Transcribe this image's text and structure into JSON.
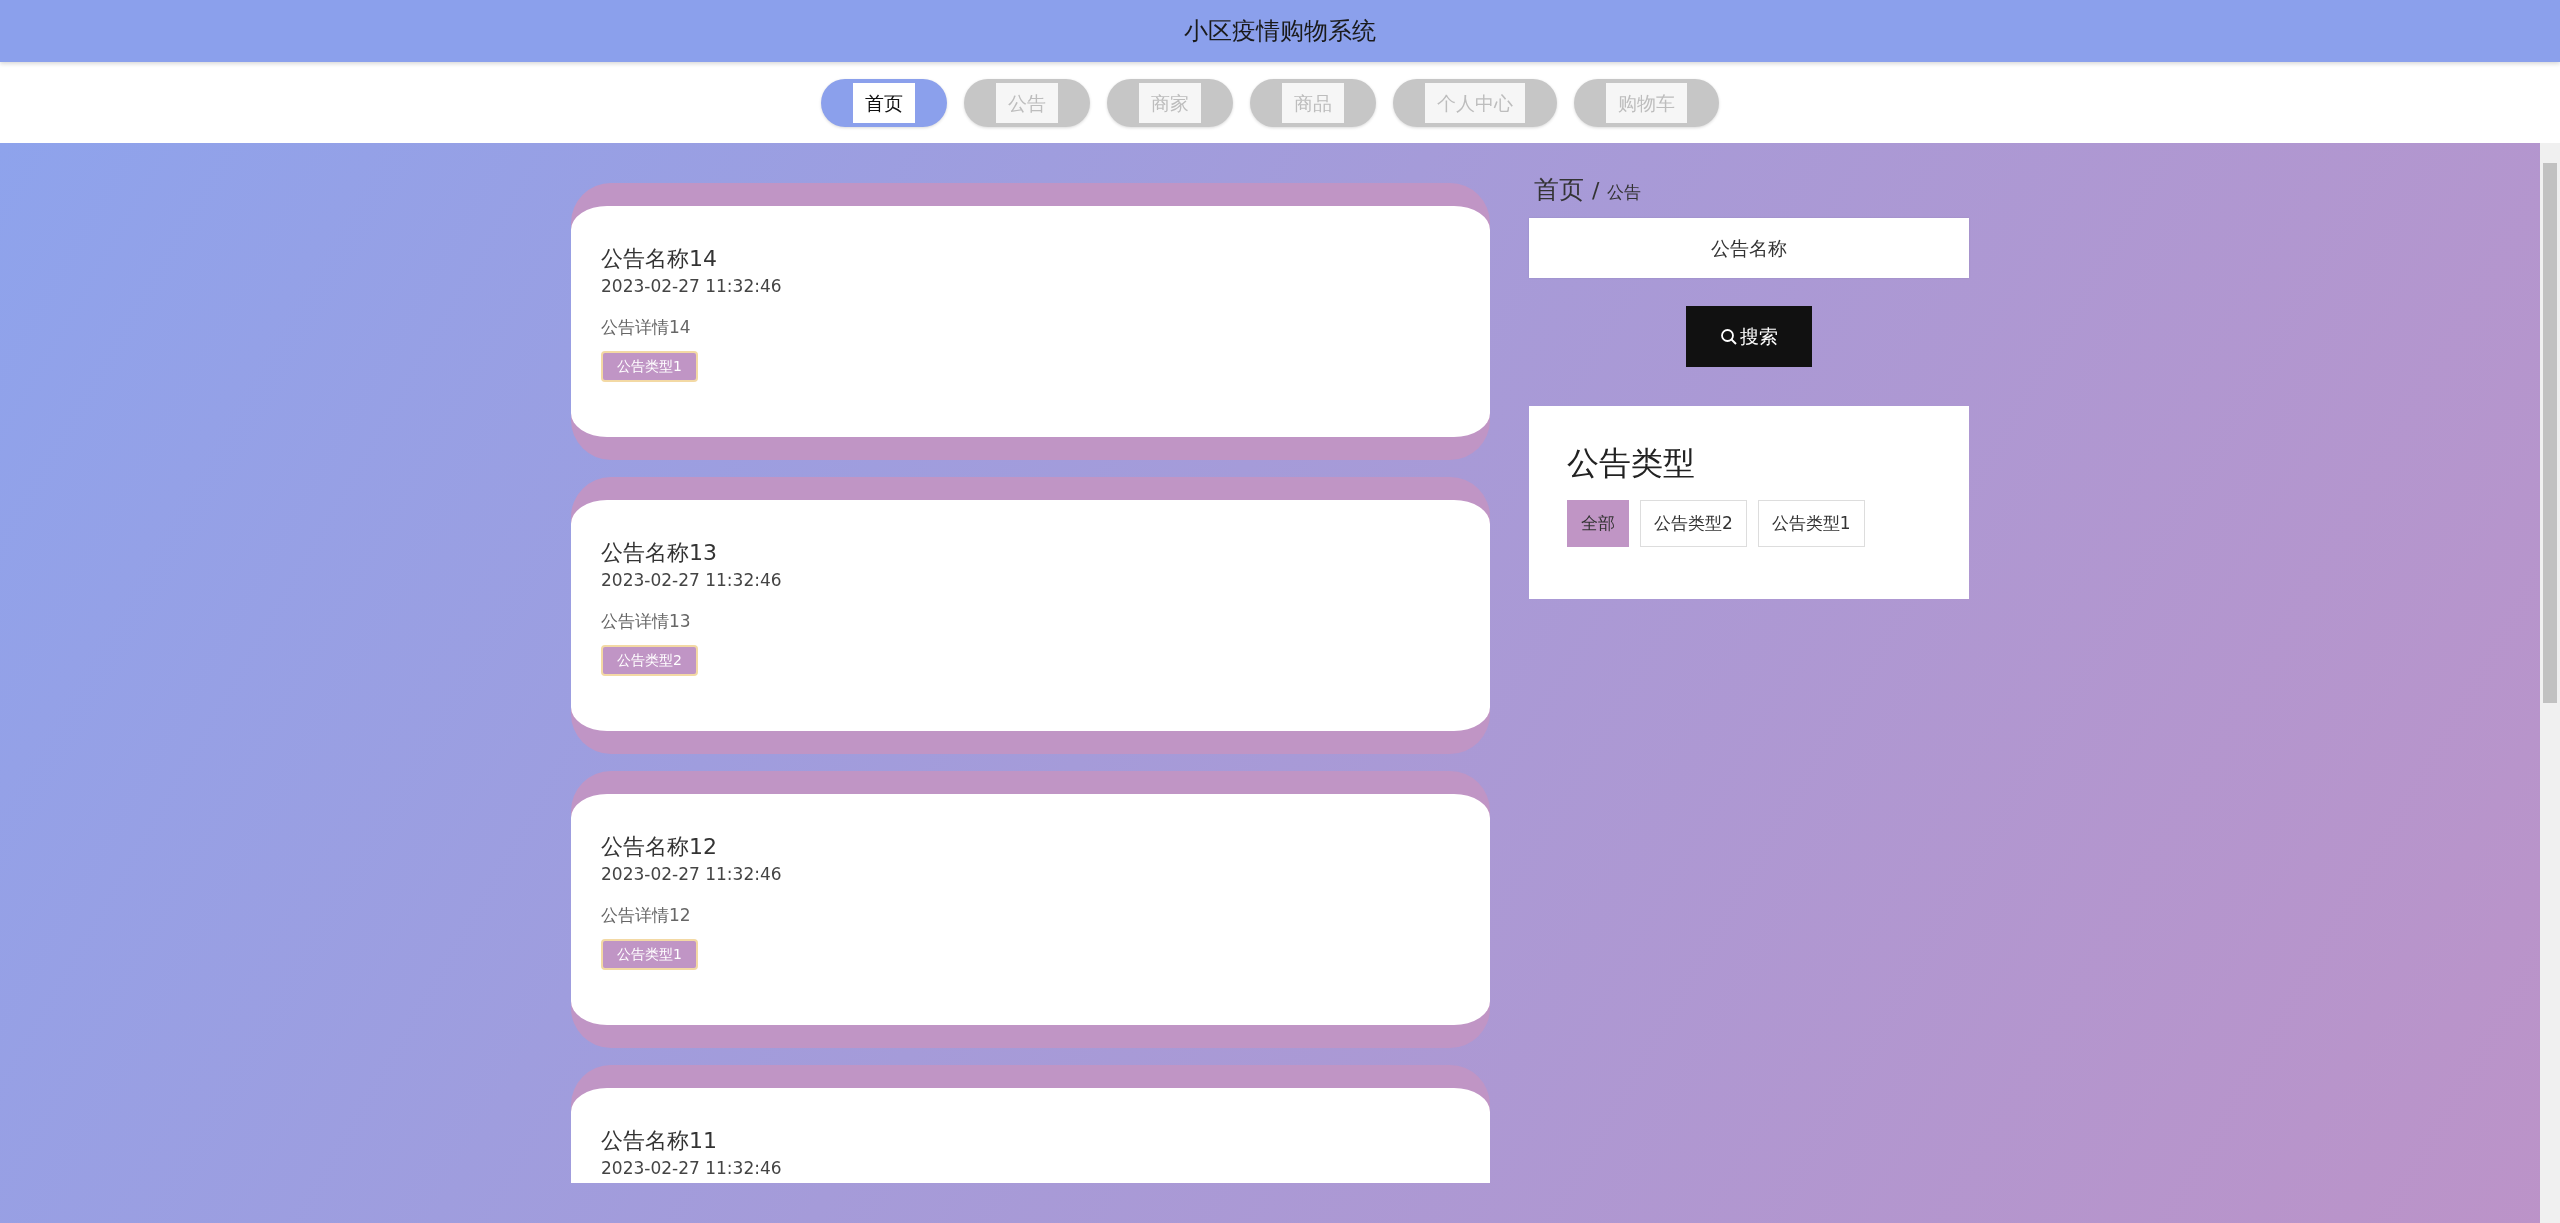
{
  "header": {
    "title": "小区疫情购物系统"
  },
  "nav": {
    "tabs": [
      {
        "label": "首页",
        "selected": true
      },
      {
        "label": "公告",
        "selected": false
      },
      {
        "label": "商家",
        "selected": false
      },
      {
        "label": "商品",
        "selected": false
      },
      {
        "label": "个人中心",
        "selected": false
      },
      {
        "label": "购物车",
        "selected": false
      }
    ]
  },
  "notices": [
    {
      "title": "公告名称14",
      "time": "2023-02-27 11:32:46",
      "detail": "公告详情14",
      "type": "公告类型1"
    },
    {
      "title": "公告名称13",
      "time": "2023-02-27 11:32:46",
      "detail": "公告详情13",
      "type": "公告类型2"
    },
    {
      "title": "公告名称12",
      "time": "2023-02-27 11:32:46",
      "detail": "公告详情12",
      "type": "公告类型1"
    },
    {
      "title": "公告名称11",
      "time": "2023-02-27 11:32:46"
    }
  ],
  "sidebar": {
    "breadcrumb": {
      "home": "首页",
      "separator": "/",
      "current": "公告"
    },
    "search": {
      "placeholder": "公告名称",
      "button": "搜索"
    },
    "types": {
      "title": "公告类型",
      "filters": [
        {
          "label": "全部",
          "selected": true
        },
        {
          "label": "公告类型2",
          "selected": false
        },
        {
          "label": "公告类型1",
          "selected": false
        }
      ]
    }
  }
}
